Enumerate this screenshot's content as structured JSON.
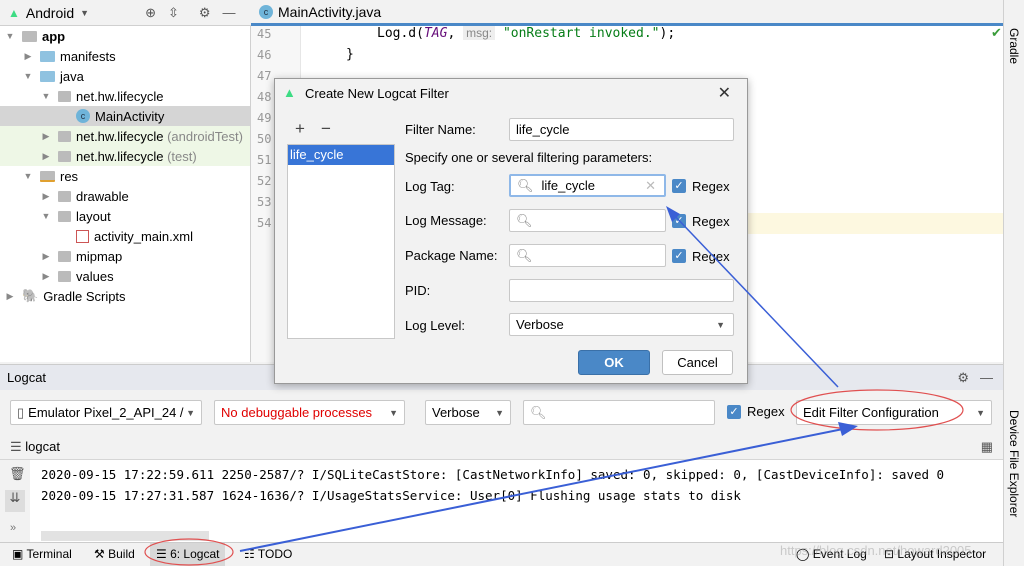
{
  "project_panel": {
    "view": "Android",
    "tree": [
      {
        "label": "app",
        "bold": true
      },
      {
        "label": "manifests"
      },
      {
        "label": "java"
      },
      {
        "label": "net.hw.lifecycle"
      },
      {
        "label": "MainActivity",
        "selected": true
      },
      {
        "label": "net.hw.lifecycle",
        "suffix": "(androidTest)"
      },
      {
        "label": "net.hw.lifecycle",
        "suffix": "(test)"
      },
      {
        "label": "res"
      },
      {
        "label": "drawable"
      },
      {
        "label": "layout"
      },
      {
        "label": "activity_main.xml"
      },
      {
        "label": "mipmap"
      },
      {
        "label": "values"
      },
      {
        "label": "Gradle Scripts"
      }
    ]
  },
  "editor": {
    "tab": "MainActivity.java",
    "line_numbers": [
      "45",
      "46",
      "47",
      "48",
      "49",
      "50",
      "51",
      "52",
      "53",
      "54"
    ],
    "code_45": {
      "call": "Log.d(",
      "tag": "TAG",
      "comma": ", ",
      "hint": "msg:",
      "str": "\"onRestart invoked.\"",
      "end": ");"
    },
    "code_46": "}"
  },
  "right_strip": {
    "gradle": "Gradle",
    "device_explorer": "Device File Explorer"
  },
  "dialog": {
    "title": "Create New Logcat Filter",
    "add": "+",
    "remove": "−",
    "filters": [
      "life_cycle"
    ],
    "filter_name_label": "Filter Name:",
    "filter_name": "life_cycle",
    "hint": "Specify one or several filtering parameters:",
    "log_tag_label": "Log Tag:",
    "log_tag": "life_cycle",
    "log_message_label": "Log Message:",
    "log_message": "",
    "package_label": "Package Name:",
    "package": "",
    "pid_label": "PID:",
    "pid": "",
    "regex": "Regex",
    "log_level_label": "Log Level:",
    "log_level": "Verbose",
    "ok": "OK",
    "cancel": "Cancel"
  },
  "logcat": {
    "title": "Logcat",
    "device": "Emulator Pixel_2_API_24 /",
    "process": "No debuggable processes",
    "level": "Verbose",
    "search": "",
    "regex": "Regex",
    "filter_config": "Edit Filter Configuration",
    "tab": "logcat",
    "lines": [
      "2020-09-15 17:22:59.611 2250-2587/? I/SQLiteCastStore: [CastNetworkInfo] saved: 0, skipped: 0, [CastDeviceInfo]: saved 0",
      "2020-09-15 17:27:31.587 1624-1636/? I/UsageStatsService: User[0] Flushing usage stats to disk"
    ]
  },
  "bottom_bar": {
    "terminal": "Terminal",
    "build": "Build",
    "logcat": "6: Logcat",
    "todo": "TODO",
    "event_log": "Event Log",
    "layout_inspector": "Layout Inspector"
  },
  "watermark": "https://blog.csdn.net/howard2005",
  "colors": {
    "accent": "#4a88c7",
    "annotation_arrow": "#3a5fd6",
    "annotation_circle": "#e05050",
    "error_text": "#e00000",
    "android_green": "#3ddc84"
  }
}
